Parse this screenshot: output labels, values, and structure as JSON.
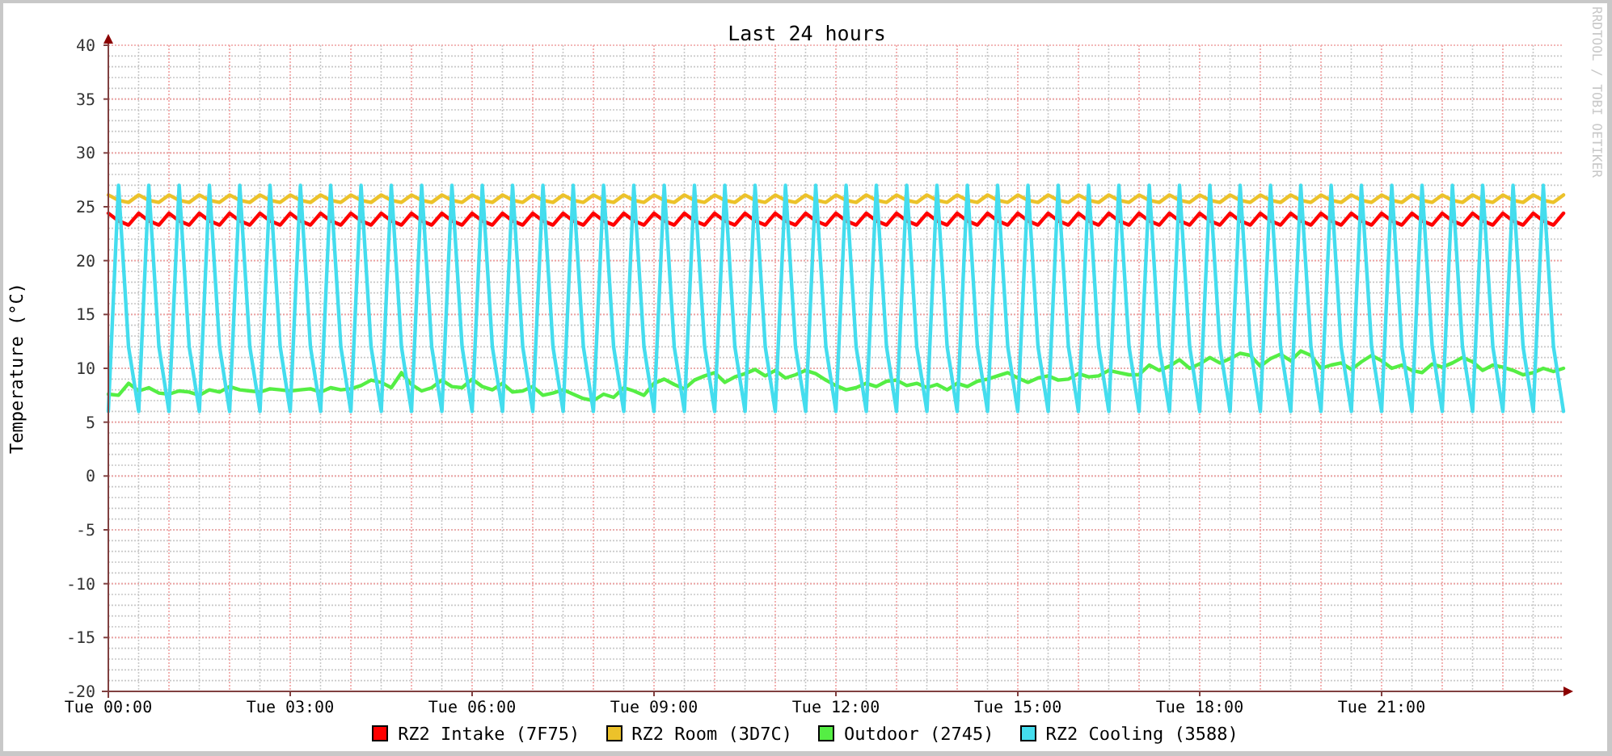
{
  "chart": {
    "credit": "RRDTOOL / TOBI OETIKER",
    "chart_data": {
      "type": "line",
      "title": "Last 24 hours",
      "ylabel": "Temperature (°C)",
      "ylim": [
        -20,
        40
      ],
      "grid": true,
      "legend": true,
      "yticks": [
        -20,
        -15,
        -10,
        -5,
        0,
        5,
        10,
        15,
        20,
        25,
        30,
        35,
        40
      ],
      "categories": [
        "Tue 00:00",
        null,
        null,
        null,
        null,
        null,
        null,
        null,
        null,
        null,
        null,
        null,
        null,
        null,
        null,
        null,
        null,
        null,
        "Tue 03:00",
        null,
        null,
        null,
        null,
        null,
        null,
        null,
        null,
        null,
        null,
        null,
        null,
        null,
        null,
        null,
        null,
        null,
        "Tue 06:00",
        null,
        null,
        null,
        null,
        null,
        null,
        null,
        null,
        null,
        null,
        null,
        null,
        null,
        null,
        null,
        null,
        null,
        "Tue 09:00",
        null,
        null,
        null,
        null,
        null,
        null,
        null,
        null,
        null,
        null,
        null,
        null,
        null,
        null,
        null,
        null,
        null,
        "Tue 12:00",
        null,
        null,
        null,
        null,
        null,
        null,
        null,
        null,
        null,
        null,
        null,
        null,
        null,
        null,
        null,
        null,
        null,
        "Tue 15:00",
        null,
        null,
        null,
        null,
        null,
        null,
        null,
        null,
        null,
        null,
        null,
        null,
        null,
        null,
        null,
        null,
        null,
        "Tue 18:00",
        null,
        null,
        null,
        null,
        null,
        null,
        null,
        null,
        null,
        null,
        null,
        null,
        null,
        null,
        null,
        null,
        null,
        "Tue 21:00",
        null,
        null,
        null,
        null,
        null,
        null,
        null,
        null,
        null,
        null,
        null,
        null,
        null,
        null,
        null,
        null,
        null,
        null
      ],
      "series": [
        {
          "name": "RZ2 Intake (7F75)",
          "color": "#ff0000",
          "values": [
            24.4,
            23.7,
            23.3,
            24.4,
            23.7,
            23.3,
            24.4,
            23.7,
            23.3,
            24.4,
            23.7,
            23.3,
            24.4,
            23.7,
            23.3,
            24.4,
            23.7,
            23.3,
            24.4,
            23.7,
            23.3,
            24.4,
            23.7,
            23.3,
            24.4,
            23.7,
            23.3,
            24.4,
            23.7,
            23.3,
            24.4,
            23.7,
            23.3,
            24.4,
            23.7,
            23.3,
            24.4,
            23.7,
            23.3,
            24.4,
            23.7,
            23.3,
            24.4,
            23.7,
            23.3,
            24.4,
            23.7,
            23.3,
            24.4,
            23.7,
            23.3,
            24.4,
            23.7,
            23.3,
            24.4,
            23.7,
            23.3,
            24.4,
            23.7,
            23.3,
            24.4,
            23.7,
            23.3,
            24.4,
            23.7,
            23.3,
            24.4,
            23.7,
            23.3,
            24.4,
            23.7,
            23.3,
            24.4,
            23.7,
            23.3,
            24.4,
            23.7,
            23.3,
            24.4,
            23.7,
            23.3,
            24.4,
            23.7,
            23.3,
            24.4,
            23.7,
            23.3,
            24.4,
            23.7,
            23.3,
            24.4,
            23.7,
            23.3,
            24.4,
            23.7,
            23.3,
            24.4,
            23.7,
            23.3,
            24.4,
            23.7,
            23.3,
            24.4,
            23.7,
            23.3,
            24.4,
            23.7,
            23.3,
            24.4,
            23.7,
            23.3,
            24.4,
            23.7,
            23.3,
            24.4,
            23.7,
            23.3,
            24.4,
            23.7,
            23.3,
            24.4,
            23.7,
            23.3,
            24.4,
            23.7,
            23.3,
            24.4,
            23.7,
            23.3,
            24.4,
            23.7,
            23.3,
            24.4,
            23.7,
            23.3,
            24.4,
            23.7,
            23.3,
            24.4,
            23.7,
            23.3,
            24.4,
            23.7,
            23.3,
            24.4
          ]
        },
        {
          "name": "RZ2 Room (3D7C)",
          "color": "#ecc22a",
          "values": [
            26.1,
            25.6,
            25.4,
            26.1,
            25.6,
            25.4,
            26.1,
            25.6,
            25.4,
            26.1,
            25.6,
            25.4,
            26.1,
            25.6,
            25.4,
            26.1,
            25.6,
            25.4,
            26.1,
            25.6,
            25.4,
            26.1,
            25.6,
            25.4,
            26.1,
            25.6,
            25.4,
            26.1,
            25.6,
            25.4,
            26.1,
            25.6,
            25.4,
            26.1,
            25.6,
            25.4,
            26.1,
            25.6,
            25.4,
            26.1,
            25.6,
            25.4,
            26.1,
            25.6,
            25.4,
            26.1,
            25.6,
            25.4,
            26.1,
            25.6,
            25.4,
            26.1,
            25.6,
            25.4,
            26.1,
            25.6,
            25.4,
            26.1,
            25.6,
            25.4,
            26.1,
            25.6,
            25.4,
            26.1,
            25.6,
            25.4,
            26.1,
            25.6,
            25.4,
            26.1,
            25.6,
            25.4,
            26.1,
            25.6,
            25.4,
            26.1,
            25.6,
            25.4,
            26.1,
            25.6,
            25.4,
            26.1,
            25.6,
            25.4,
            26.1,
            25.6,
            25.4,
            26.1,
            25.6,
            25.4,
            26.1,
            25.6,
            25.4,
            26.1,
            25.6,
            25.4,
            26.1,
            25.6,
            25.4,
            26.1,
            25.6,
            25.4,
            26.1,
            25.6,
            25.4,
            26.1,
            25.6,
            25.4,
            26.1,
            25.6,
            25.4,
            26.1,
            25.6,
            25.4,
            26.1,
            25.6,
            25.4,
            26.1,
            25.6,
            25.4,
            26.1,
            25.6,
            25.4,
            26.1,
            25.6,
            25.4,
            26.1,
            25.6,
            25.4,
            26.1,
            25.6,
            25.4,
            26.1,
            25.6,
            25.4,
            26.1,
            25.6,
            25.4,
            26.1,
            25.6,
            25.4,
            26.1,
            25.6,
            25.4,
            26.1
          ]
        },
        {
          "name": "Outdoor (2745)",
          "color": "#55ee44",
          "values": [
            7.6,
            7.5,
            8.6,
            7.9,
            8.2,
            7.7,
            7.6,
            7.9,
            7.8,
            7.5,
            8.0,
            7.8,
            8.3,
            8.0,
            7.9,
            7.8,
            8.1,
            8.0,
            7.9,
            8.0,
            8.1,
            7.8,
            8.2,
            8.0,
            8.1,
            8.4,
            8.9,
            8.7,
            8.2,
            9.6,
            8.5,
            7.9,
            8.2,
            8.9,
            8.3,
            8.2,
            9.0,
            8.3,
            8.0,
            8.6,
            7.8,
            7.9,
            8.3,
            7.5,
            7.7,
            8.0,
            7.6,
            7.2,
            7.0,
            7.6,
            7.3,
            8.2,
            7.9,
            7.5,
            8.6,
            9.0,
            8.5,
            8.1,
            8.9,
            9.3,
            9.6,
            8.7,
            9.2,
            9.5,
            9.9,
            9.3,
            9.8,
            9.1,
            9.4,
            9.8,
            9.5,
            8.9,
            8.4,
            8.0,
            8.2,
            8.6,
            8.3,
            8.8,
            8.9,
            8.4,
            8.6,
            8.2,
            8.5,
            8.0,
            8.6,
            8.3,
            8.8,
            9.0,
            9.3,
            9.6,
            9.1,
            8.7,
            9.1,
            9.3,
            8.9,
            9.0,
            9.5,
            9.2,
            9.3,
            9.8,
            9.6,
            9.4,
            9.4,
            10.3,
            9.8,
            10.2,
            10.8,
            10.0,
            10.4,
            11.0,
            10.5,
            10.9,
            11.4,
            11.2,
            10.2,
            10.9,
            11.3,
            10.7,
            11.6,
            11.2,
            10.0,
            10.3,
            10.5,
            9.9,
            10.6,
            11.2,
            10.7,
            10.0,
            10.3,
            9.8,
            9.6,
            10.4,
            10.1,
            10.5,
            11.0,
            10.6,
            9.8,
            10.3,
            10.1,
            9.8,
            9.4,
            9.6,
            10.0,
            9.7,
            10.0
          ]
        },
        {
          "name": "RZ2 Cooling (3588)",
          "color": "#44ddee",
          "values": [
            6,
            27,
            12,
            6,
            27,
            12,
            6,
            27,
            12,
            6,
            27,
            12,
            6,
            27,
            12,
            6,
            27,
            12,
            6,
            27,
            12,
            6,
            27,
            12,
            6,
            27,
            12,
            6,
            27,
            12,
            6,
            27,
            12,
            6,
            27,
            12,
            6,
            27,
            12,
            6,
            27,
            12,
            6,
            27,
            12,
            6,
            27,
            12,
            6,
            27,
            12,
            6,
            27,
            12,
            6,
            27,
            12,
            6,
            27,
            12,
            6,
            27,
            12,
            6,
            27,
            12,
            6,
            27,
            12,
            6,
            27,
            12,
            6,
            27,
            12,
            6,
            27,
            12,
            6,
            27,
            12,
            6,
            27,
            12,
            6,
            27,
            12,
            6,
            27,
            12,
            6,
            27,
            12,
            6,
            27,
            12,
            6,
            27,
            12,
            6,
            27,
            12,
            6,
            27,
            12,
            6,
            27,
            12,
            6,
            27,
            12,
            6,
            27,
            12,
            6,
            27,
            12,
            6,
            27,
            12,
            6,
            27,
            12,
            6,
            27,
            12,
            6,
            27,
            12,
            6,
            27,
            12,
            6,
            27,
            12,
            6,
            27,
            12,
            6,
            27,
            12,
            6,
            27,
            12,
            6
          ]
        }
      ]
    }
  }
}
